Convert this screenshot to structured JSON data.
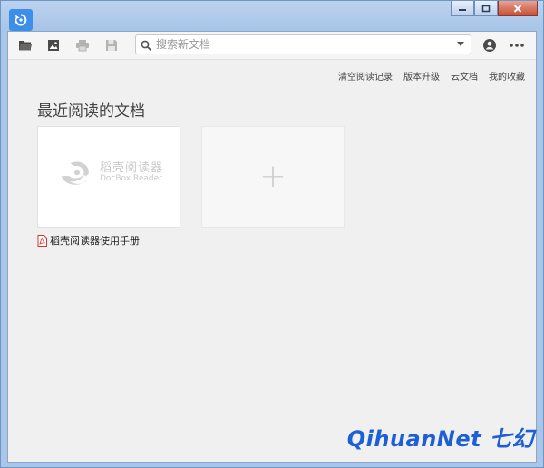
{
  "window": {
    "buttons": [
      "minimize",
      "maximize",
      "close"
    ]
  },
  "toolbar": {
    "icons": [
      "open-folder-icon",
      "image-icon",
      "print-icon",
      "save-icon"
    ],
    "search": {
      "placeholder": "搜索新文档",
      "value": ""
    },
    "right_icons": [
      "user-icon",
      "more-icon"
    ]
  },
  "links": {
    "clear_history": "清空阅读记录",
    "version_upgrade": "版本升级",
    "cloud_docs": "云文档",
    "my_favorites": "我的收藏"
  },
  "main": {
    "section_title": "最近阅读的文档",
    "documents": [
      {
        "thumb_cn": "稻壳阅读器",
        "thumb_en": "DocBox Reader",
        "name": "稻壳阅读器使用手册",
        "type": "pdf"
      }
    ],
    "add_label": "+"
  },
  "watermark": "QihuanNet 七幻",
  "colors": {
    "accent": "#3d8ee8",
    "pdf_red": "#d9342b",
    "watermark": "#1d5fd6"
  }
}
